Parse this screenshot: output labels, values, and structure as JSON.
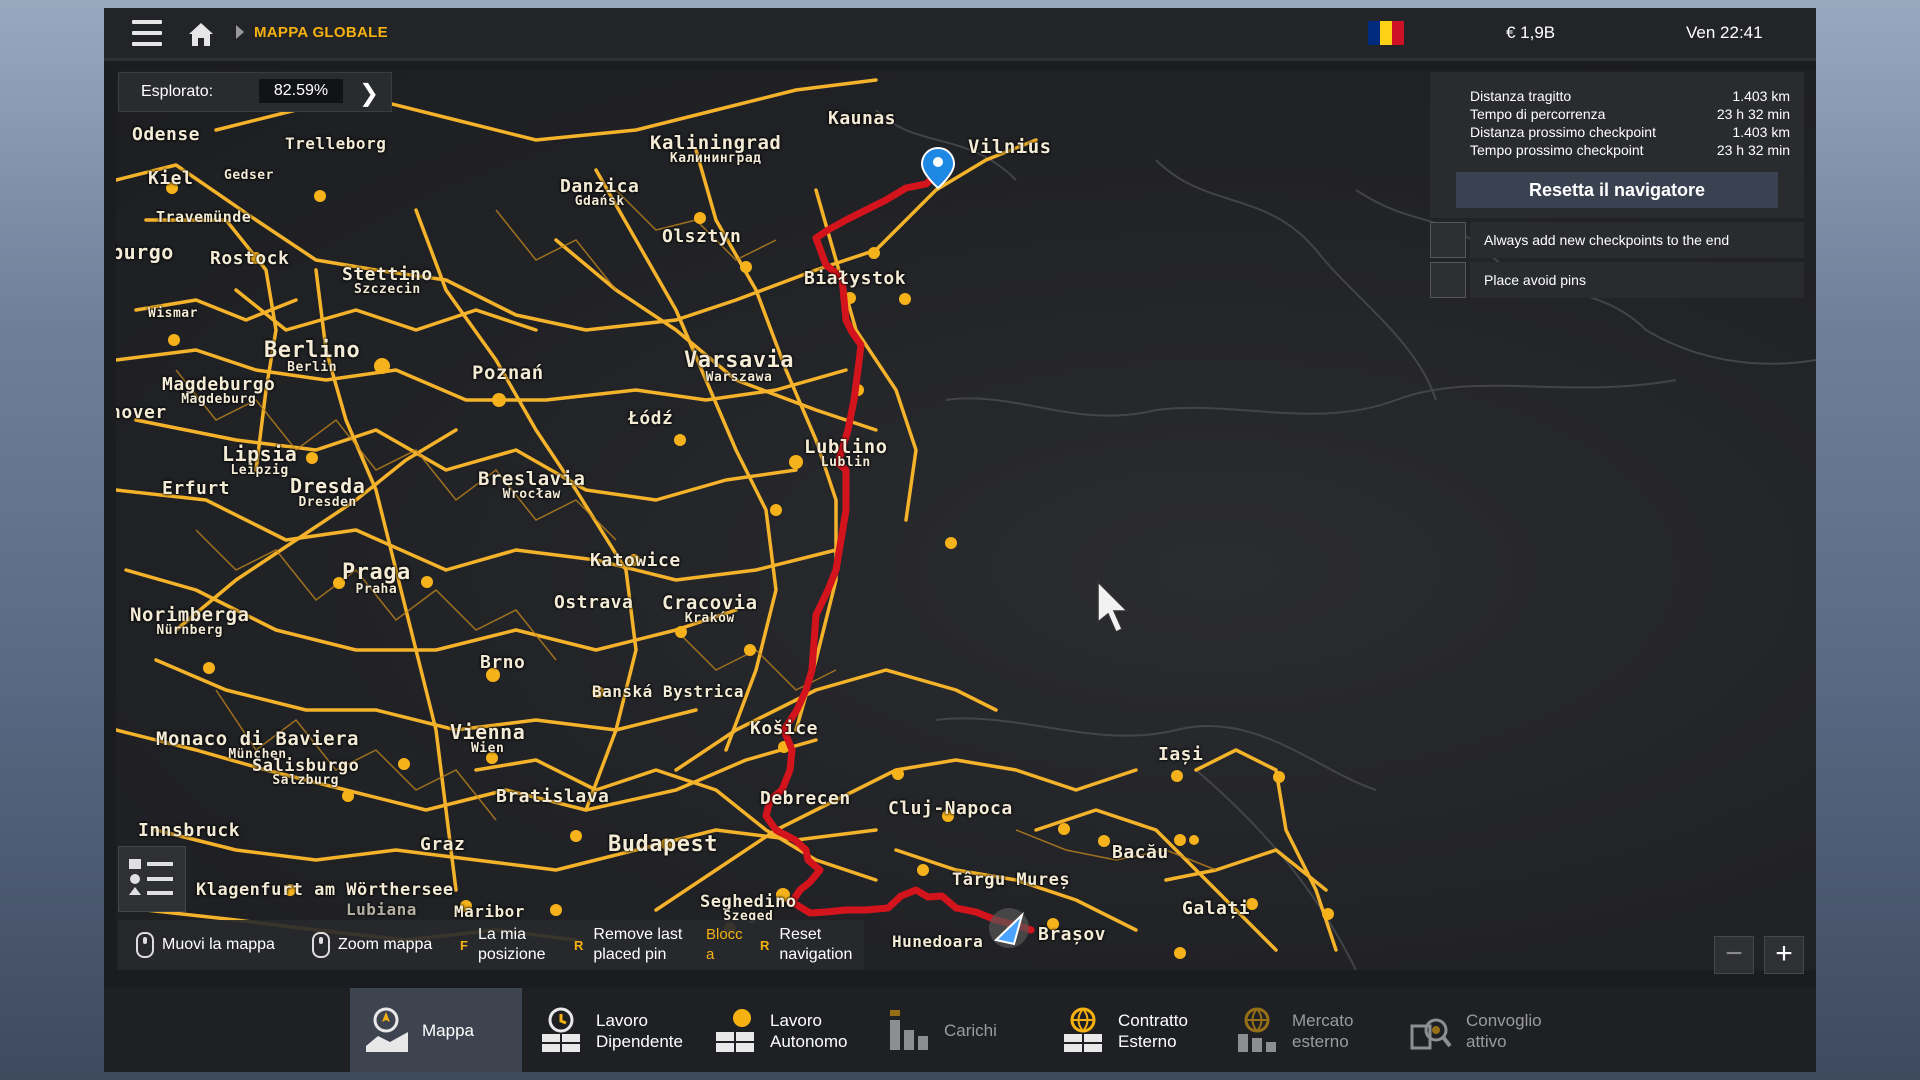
{
  "topbar": {
    "breadcrumb": "MAPPA GLOBALE",
    "money": "€ 1,9B",
    "clock": "Ven 22:41",
    "flag_colors": [
      "#002b7f",
      "#fcd116",
      "#ce1126"
    ]
  },
  "explored": {
    "label": "Esplorato:",
    "value": "82.59%"
  },
  "route_panel": {
    "rows": [
      {
        "label": "Distanza tragitto",
        "value": "1.403 km"
      },
      {
        "label": "Tempo di percorrenza",
        "value": "23 h 32 min"
      },
      {
        "label": "Distanza prossimo checkpoint",
        "value": "1.403 km"
      },
      {
        "label": "Tempo prossimo checkpoint",
        "value": "23 h 32 min"
      }
    ],
    "reset_label": "Resetta il navigatore",
    "option1": "Always add new checkpoints to the end",
    "option2": "Place avoid pins"
  },
  "cities": [
    {
      "name": "Odense"
    },
    {
      "name": "Trelleborg"
    },
    {
      "name": "Kiel"
    },
    {
      "name": "Gedser"
    },
    {
      "name": "Travemünde"
    },
    {
      "name": "Rostock"
    },
    {
      "name": "Amburgo"
    },
    {
      "name": "Wismar"
    },
    {
      "name": "Stettino",
      "sub": "Szczecin"
    },
    {
      "name": "Danzica",
      "sub": "Gdańsk"
    },
    {
      "name": "Kaliningrad",
      "sub": "Калининград"
    },
    {
      "name": "Kaunas"
    },
    {
      "name": "Vilnius"
    },
    {
      "name": "Olsztyn"
    },
    {
      "name": "Białystok"
    },
    {
      "name": "Berlino",
      "sub": "Berlin"
    },
    {
      "name": "Magdeburgo",
      "sub": "Magdeburg"
    },
    {
      "name": "Poznań"
    },
    {
      "name": "Varsavia",
      "sub": "Warszawa"
    },
    {
      "name": "Hannover"
    },
    {
      "name": "Łódź"
    },
    {
      "name": "Lublino",
      "sub": "Lublin"
    },
    {
      "name": "Lipsia",
      "sub": "Leipzig"
    },
    {
      "name": "Erfurt"
    },
    {
      "name": "Dresda",
      "sub": "Dresden"
    },
    {
      "name": "Breslavia",
      "sub": "Wrocław"
    },
    {
      "name": "Katowice"
    },
    {
      "name": "Praga",
      "sub": "Praha"
    },
    {
      "name": "Ostrava"
    },
    {
      "name": "Cracovia",
      "sub": "Kraków"
    },
    {
      "name": "Norimberga",
      "sub": "Nürnberg"
    },
    {
      "name": "Brno"
    },
    {
      "name": "Banská Bystrica"
    },
    {
      "name": "Košice"
    },
    {
      "name": "Monaco di Baviera",
      "sub": "München"
    },
    {
      "name": "Salisburgo",
      "sub": "Salzburg"
    },
    {
      "name": "Vienna",
      "sub": "Wien"
    },
    {
      "name": "Bratislava"
    },
    {
      "name": "Debrecen"
    },
    {
      "name": "Cluj-Napoca"
    },
    {
      "name": "Iași"
    },
    {
      "name": "Innsbruck"
    },
    {
      "name": "Graz"
    },
    {
      "name": "Budapest"
    },
    {
      "name": "Bacău"
    },
    {
      "name": "Târgu Mureș"
    },
    {
      "name": "Klagenfurt am Wörthersee"
    },
    {
      "name": "Lubiana"
    },
    {
      "name": "Maribor"
    },
    {
      "name": "Seghedino",
      "sub": "Szeged"
    },
    {
      "name": "Galați"
    },
    {
      "name": "Hunedoara"
    },
    {
      "name": "Brașov"
    }
  ],
  "help": {
    "move": "Muovi la mappa",
    "zoom": "Zoom mappa",
    "key_f": "F",
    "mypos": "La mia posizione",
    "key_r": "R",
    "remove": "Remove last placed pin",
    "block_key": "Blocc a",
    "key_r2": "R",
    "reset": "Reset navigation"
  },
  "zoom": {
    "minus": "−",
    "plus": "+"
  },
  "nav": [
    {
      "label": "Mappa",
      "icon": "map-icon"
    },
    {
      "label": "Lavoro Dipendente",
      "icon": "clock-job-icon"
    },
    {
      "label": "Lavoro Autonomo",
      "icon": "own-job-icon"
    },
    {
      "label": "Carichi",
      "icon": "cargo-icon"
    },
    {
      "label": "Contratto Esterno",
      "icon": "globe-contract-icon"
    },
    {
      "label": "Mercato esterno",
      "icon": "globe-market-icon"
    },
    {
      "label": "Convoglio attivo",
      "icon": "convoy-icon"
    }
  ],
  "colors": {
    "accent": "#f5b10f",
    "road": "#f4b32a",
    "route": "#d4141c",
    "active_tab": "#3e4350"
  }
}
